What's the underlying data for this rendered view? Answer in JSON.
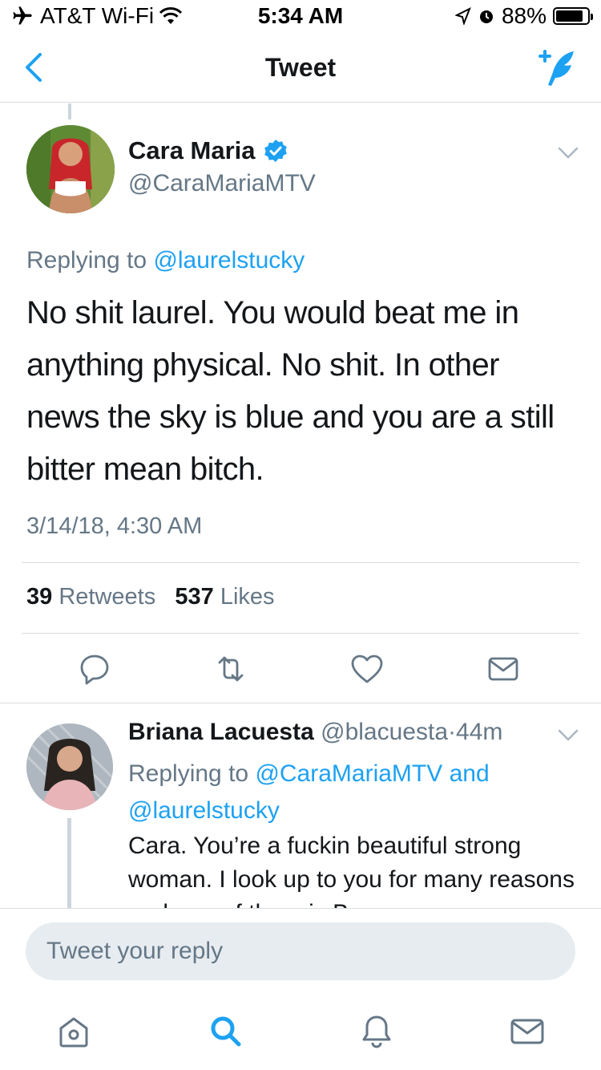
{
  "status_bar": {
    "carrier": "AT&T Wi-Fi",
    "time": "5:34 AM",
    "battery": "88%",
    "battery_level": 0.88
  },
  "nav": {
    "title": "Tweet",
    "back_icon": "chevron-left-icon",
    "compose_icon": "compose-tweet-icon"
  },
  "tweet": {
    "author_name": "Cara Maria",
    "author_handle": "@CaraMariaMTV",
    "verified": true,
    "replying_prefix": "Replying to",
    "replying_to": "@laurelstucky",
    "text": "No shit laurel. You would beat me in anything physical. No shit. In other news the sky is blue and you are a still bitter mean bitch.",
    "timestamp": "3/14/18, 4:30 AM",
    "retweets_count": "39",
    "retweets_label": "Retweets",
    "likes_count": "537",
    "likes_label": "Likes"
  },
  "reply": {
    "author_name": "Briana Lacuesta",
    "author_handle": "@blacuesta",
    "separator": "·",
    "age": "44m",
    "replying_prefix": "Replying to",
    "replying_to_1": "@CaraMariaMTV",
    "conjunction": "and",
    "replying_to_2": "@laurelstucky",
    "text": "Cara. You’re a fuckin beautiful strong woman. I look up to you for many reasons and one of them is Be you"
  },
  "composer": {
    "placeholder": "Tweet your reply"
  },
  "tab_bar": {
    "items": [
      "home-icon",
      "search-icon",
      "notifications-icon",
      "messages-icon"
    ],
    "active": "search-icon"
  },
  "colors": {
    "accent": "#1da1f2",
    "muted": "#657786",
    "text": "#14171a",
    "divider": "#d8dde1"
  }
}
